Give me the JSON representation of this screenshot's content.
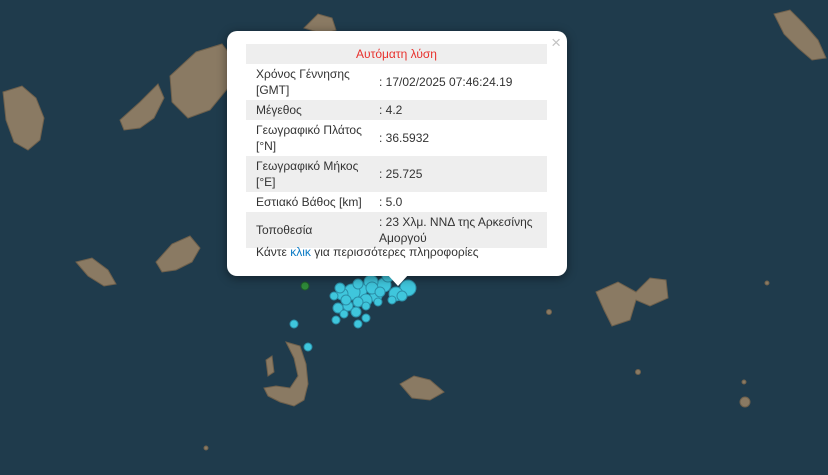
{
  "map": {
    "sea_color": "#1f3b4c",
    "land_color": "#8a7a63",
    "quake_color": "#3fc6dc",
    "quake_stroke": "#2b8fa8",
    "other_marker_color": "#2f8a3a"
  },
  "popup": {
    "title": "Αυτόματη λύση",
    "close_icon": "×",
    "rows": [
      {
        "label": "Χρόνος Γέννησης [GMT]",
        "value": ": 17/02/2025 07:46:24.19"
      },
      {
        "label": "Μέγεθος",
        "value": ": 4.2"
      },
      {
        "label": "Γεωγραφικό Πλάτος [°N]",
        "value": ": 36.5932"
      },
      {
        "label": "Γεωγραφικό Μήκος [°E]",
        "value": ": 25.725"
      },
      {
        "label": "Εστιακό Βάθος [km]",
        "value": ": 5.0"
      },
      {
        "label": "Τοποθεσία",
        "value": ": 23 Χλμ. ΝΝΔ της Αρκεσίνης Αμοργού"
      }
    ],
    "more_prefix": "Κάντε ",
    "more_link": "κλικ",
    "more_suffix": " για περισσότερες πληροφορίες"
  }
}
